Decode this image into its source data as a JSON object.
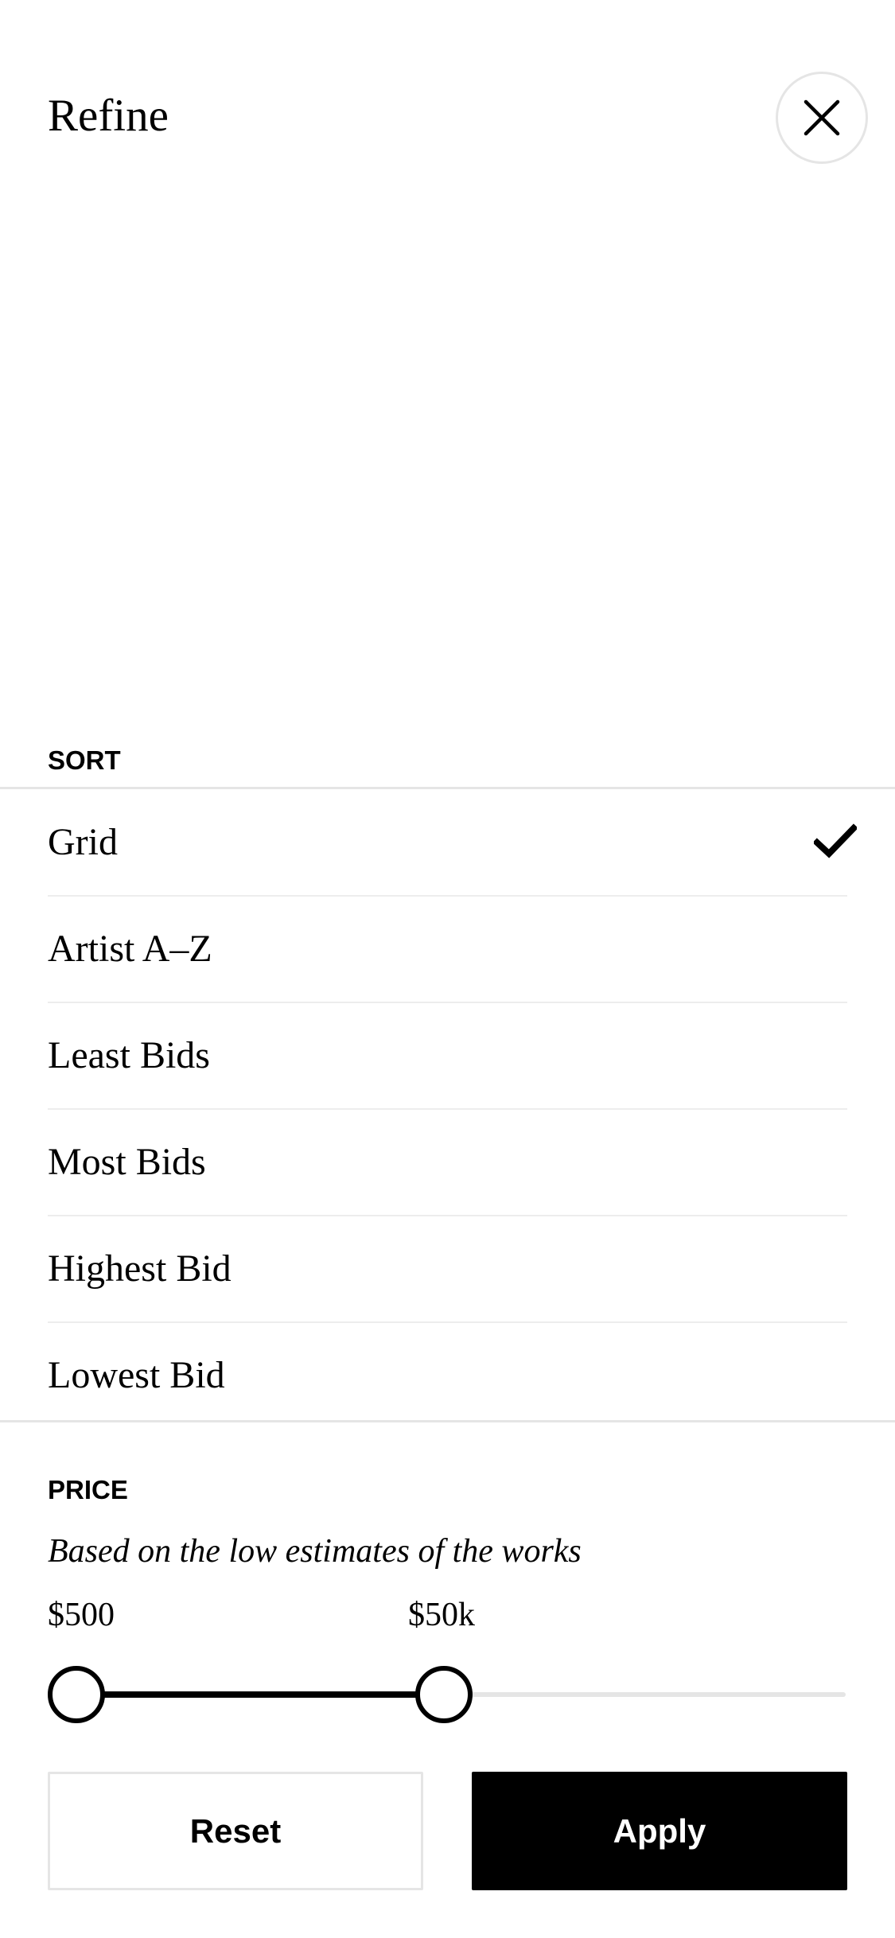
{
  "header": {
    "title": "Refine",
    "close_icon": "close-icon"
  },
  "sort": {
    "label": "SORT",
    "selected_index": 0,
    "selected_icon": "check-icon",
    "items": [
      {
        "label": "Grid",
        "selected": true
      },
      {
        "label": "Artist A–Z",
        "selected": false
      },
      {
        "label": "Least Bids",
        "selected": false
      },
      {
        "label": "Most Bids",
        "selected": false
      },
      {
        "label": "Highest Bid",
        "selected": false
      },
      {
        "label": "Lowest Bid",
        "selected": false
      }
    ]
  },
  "price": {
    "label": "PRICE",
    "subtitle": "Based on the low estimates of the works",
    "min_label": "$500",
    "max_label": "$50k",
    "slider": {
      "min_fraction": 0.0,
      "max_fraction": 0.5
    }
  },
  "actions": {
    "reset_label": "Reset",
    "apply_label": "Apply"
  },
  "colors": {
    "primary": "#000000",
    "background": "#ffffff",
    "divider": "#e5e5e5"
  }
}
